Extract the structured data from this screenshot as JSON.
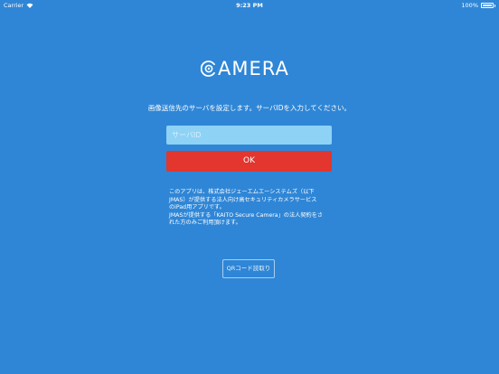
{
  "status_bar": {
    "carrier": "Carrier",
    "time": "9:23 PM",
    "battery": "100%"
  },
  "logo": {
    "text": "AMERA",
    "icon": "camera-lens-icon"
  },
  "instruction": "画像送信先のサーバを設定します。サーバIDを入力してください。",
  "server_input": {
    "placeholder": "サーバID",
    "value": ""
  },
  "ok_button": "OK",
  "notice": {
    "lines": [
      "このアプリは、株式会社ジェーエムエーシステムズ（以下",
      "JMAS）が提供する法人向け高セキュリティカメラサービス",
      "のiPad用アプリです。",
      "JMASが提供する「KAITO Secure Camera」の法人契約をさ",
      "れた方のみご利用頂けます。"
    ]
  },
  "qr_button": "QRコード読取り",
  "colors": {
    "background": "#2f86d6",
    "input_bg": "#8ed2f5",
    "ok_bg": "#e2362e"
  }
}
